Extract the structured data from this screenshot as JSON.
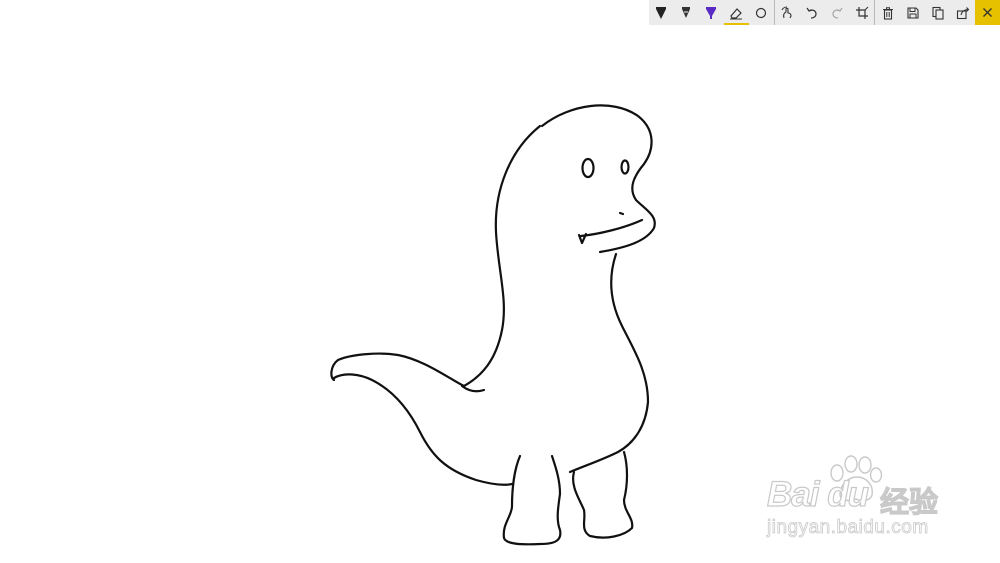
{
  "window": {
    "mode": "Ink sketch annotation"
  },
  "toolbar": {
    "tools": [
      {
        "id": "ballpoint-pen",
        "active": false
      },
      {
        "id": "pencil",
        "active": false
      },
      {
        "id": "highlighter",
        "active": false,
        "color": "#5a2bc4"
      },
      {
        "id": "eraser",
        "active": true
      },
      {
        "id": "ruler",
        "active": false
      }
    ],
    "actions": [
      {
        "id": "touch-writing"
      },
      {
        "id": "undo"
      },
      {
        "id": "redo",
        "enabled": false
      },
      {
        "id": "crop"
      },
      {
        "id": "delete"
      },
      {
        "id": "save"
      },
      {
        "id": "copy"
      },
      {
        "id": "share"
      },
      {
        "id": "close"
      }
    ],
    "colors": {
      "background": "#ececec",
      "separator": "#b9b9b9",
      "active_indicator": "#e5c100",
      "close_background": "#e5c100",
      "icon": "#333333",
      "icon_disabled": "#a8a8a8"
    }
  },
  "canvas": {
    "background": "#ffffff",
    "stroke_color": "#111111",
    "subject": "dinosaur-sketch"
  },
  "watermark": {
    "brand": "Bai du",
    "brand_cn": "经验",
    "url": "jingyan.baidu.com"
  }
}
